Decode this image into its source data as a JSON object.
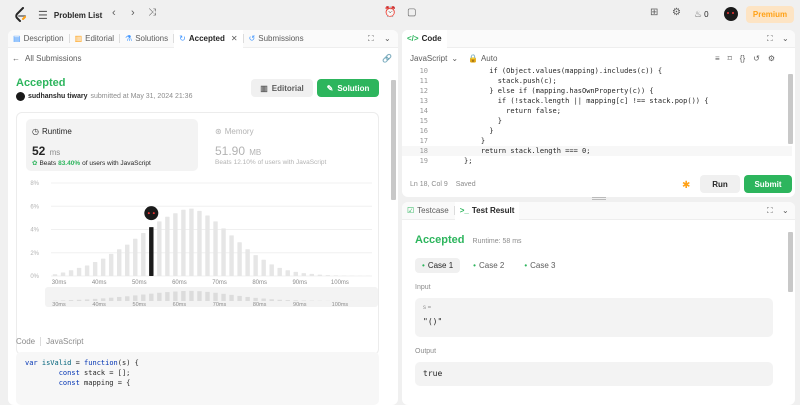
{
  "topbar": {
    "problem_list": "Problem List",
    "streak": "0",
    "premium": "Premium"
  },
  "left": {
    "tabs": [
      "Description",
      "Editorial",
      "Solutions",
      "Accepted",
      "Submissions"
    ],
    "all_submissions": "All Submissions",
    "status": "Accepted",
    "user": "sudhanshu tiwary",
    "submitted_at": "submitted at May 31, 2024 21:36",
    "editorial_btn": "Editorial",
    "solution_btn": "Solution",
    "runtime": {
      "label": "Runtime",
      "value": "52",
      "unit": "ms",
      "beats_prefix": "Beats",
      "beats_pct": "83.40%",
      "beats_suffix": "of users with JavaScript"
    },
    "memory": {
      "label": "Memory",
      "value": "51.90",
      "unit": "MB",
      "beats_prefix": "Beats",
      "beats_pct": "12.10%",
      "beats_suffix": "of users with JavaScript"
    },
    "code_label": "Code",
    "code_lang": "JavaScript",
    "code_lines": [
      "var isValid = function(s) {",
      "        const stack = [];",
      "        const mapping = {"
    ]
  },
  "chart_data": {
    "type": "bar",
    "y_ticks": [
      "8%",
      "6%",
      "4%",
      "2%",
      "0%"
    ],
    "ylim": [
      0,
      8
    ],
    "x_ticks": [
      "30ms",
      "40ms",
      "50ms",
      "60ms",
      "70ms",
      "80ms",
      "90ms",
      "100ms"
    ],
    "x_range": [
      28,
      108
    ],
    "bar_step_ms": 2,
    "highlight_ms": 52,
    "values": [
      0.15,
      0.3,
      0.5,
      0.7,
      0.9,
      1.2,
      1.5,
      1.9,
      2.3,
      2.7,
      3.2,
      3.7,
      4.2,
      4.7,
      5.1,
      5.4,
      5.7,
      5.8,
      5.6,
      5.2,
      4.7,
      4.1,
      3.5,
      2.9,
      2.3,
      1.8,
      1.4,
      1.0,
      0.7,
      0.5,
      0.35,
      0.25,
      0.18,
      0.12,
      0.08,
      0.05,
      0.03,
      0.02,
      0.01,
      0.01
    ]
  },
  "editor": {
    "title": "Code",
    "lang": "JavaScript",
    "auto": "Auto",
    "line_start": 10,
    "lines": [
      "      if (Object.values(mapping).includes(c)) {",
      "        stack.push(c);",
      "      } else if (mapping.hasOwnProperty(c)) {",
      "        if (!stack.length || mapping[c] !== stack.pop()) {",
      "          return false;",
      "        }",
      "      }",
      "    }",
      "    return stack.length === 0;",
      "};"
    ],
    "status": "Ln 18, Col 9",
    "saved": "Saved",
    "run": "Run",
    "submit": "Submit"
  },
  "results": {
    "tab_testcase": "Testcase",
    "tab_result": "Test Result",
    "status": "Accepted",
    "runtime": "Runtime: 58 ms",
    "cases": [
      "Case 1",
      "Case 2",
      "Case 3"
    ],
    "input_label": "Input",
    "input_var": "s =",
    "input_value": "\"()\"",
    "output_label": "Output",
    "output_value": "true"
  }
}
